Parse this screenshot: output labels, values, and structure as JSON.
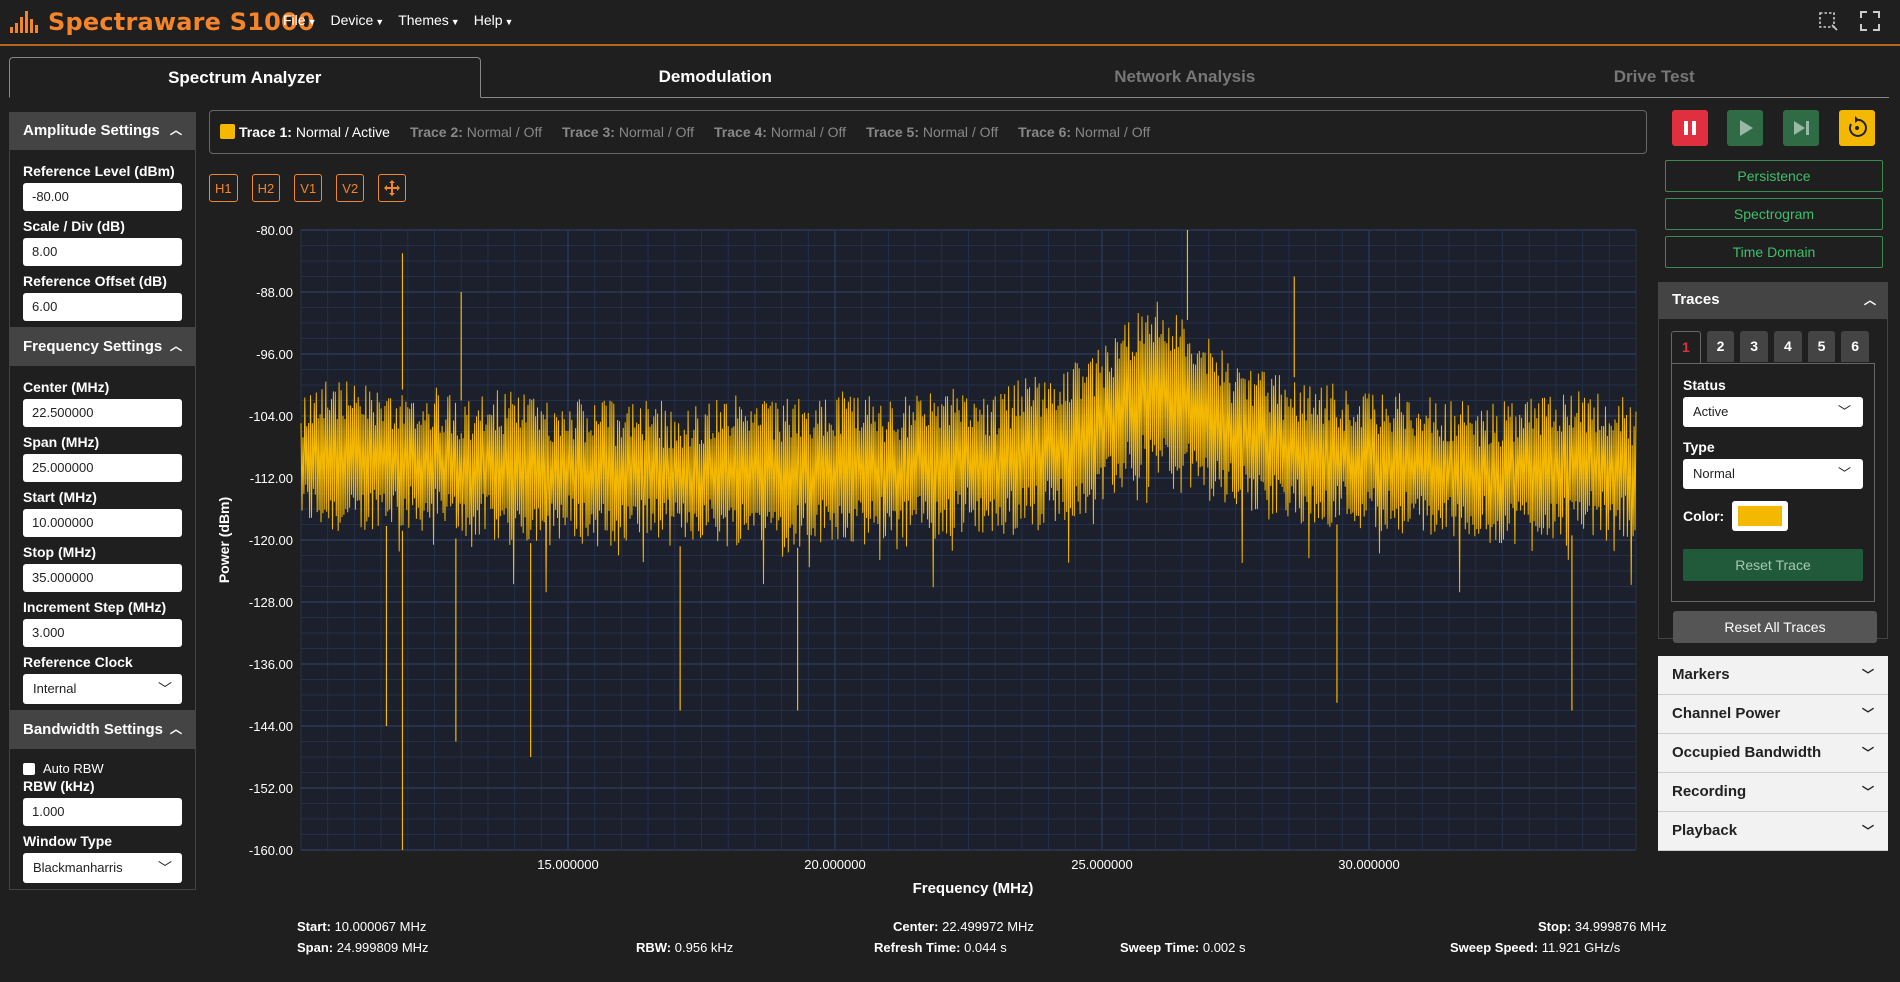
{
  "app": {
    "title": "Spectraware S1000"
  },
  "menu": [
    {
      "label": "File"
    },
    {
      "label": "Device"
    },
    {
      "label": "Themes"
    },
    {
      "label": "Help"
    }
  ],
  "tabs": [
    {
      "label": "Spectrum Analyzer"
    },
    {
      "label": "Demodulation"
    },
    {
      "label": "Network Analysis"
    },
    {
      "label": "Drive Test"
    }
  ],
  "amplitude": {
    "title": "Amplitude Settings",
    "ref_level_label": "Reference Level (dBm)",
    "ref_level": "-80.00",
    "scale_label": "Scale / Div (dB)",
    "scale": "8.00",
    "offset_label": "Reference Offset (dB)",
    "offset": "6.00"
  },
  "frequency": {
    "title": "Frequency Settings",
    "center_label": "Center (MHz)",
    "center": "22.500000",
    "span_label": "Span (MHz)",
    "span": "25.000000",
    "start_label": "Start (MHz)",
    "start": "10.000000",
    "stop_label": "Stop (MHz)",
    "stop": "35.000000",
    "step_label": "Increment Step (MHz)",
    "step": "3.000",
    "clock_label": "Reference Clock",
    "clock": "Internal"
  },
  "bandwidth": {
    "title": "Bandwidth Settings",
    "auto_rbw_label": "Auto RBW",
    "rbw_label": "RBW (kHz)",
    "rbw": "1.000",
    "window_label": "Window Type",
    "window": "Blackmanharris"
  },
  "tracebar": [
    {
      "name": "Trace 1:",
      "state": "Normal / Active",
      "color": "#f5b800"
    },
    {
      "name": "Trace 2:",
      "state": "Normal / Off"
    },
    {
      "name": "Trace 3:",
      "state": "Normal / Off"
    },
    {
      "name": "Trace 4:",
      "state": "Normal / Off"
    },
    {
      "name": "Trace 5:",
      "state": "Normal / Off"
    },
    {
      "name": "Trace 6:",
      "state": "Normal / Off"
    }
  ],
  "tools": [
    "H1",
    "H2",
    "V1",
    "V2"
  ],
  "view_buttons": [
    "Persistence",
    "Spectrogram",
    "Time Domain"
  ],
  "traces_panel": {
    "title": "Traces",
    "tabs": [
      "1",
      "2",
      "3",
      "4",
      "5",
      "6"
    ],
    "status_label": "Status",
    "status": "Active",
    "type_label": "Type",
    "type": "Normal",
    "color_label": "Color:",
    "color": "#f5b800",
    "reset_trace": "Reset Trace",
    "reset_all": "Reset All Traces"
  },
  "accordions": [
    "Markers",
    "Channel Power",
    "Occupied Bandwidth",
    "Recording",
    "Playback"
  ],
  "sweep_info": {
    "start_label": "Start:",
    "start": "10.000067 MHz",
    "span_label": "Span:",
    "span": "24.999809 MHz",
    "rbw_label": "RBW:",
    "rbw": "0.956 kHz",
    "center_label": "Center:",
    "center": "22.499972 MHz",
    "refresh_label": "Refresh Time:",
    "refresh": "0.044 s",
    "sweep_time_label": "Sweep Time:",
    "sweep_time": "0.002 s",
    "stop_label": "Stop:",
    "stop": "34.999876 MHz",
    "sweep_speed_label": "Sweep Speed:",
    "sweep_speed": "11.921 GHz/s"
  },
  "colors": {
    "accent": "#f5852a",
    "trace": "#f5b800",
    "green": "#3fbf6a",
    "pause": "#e03040"
  },
  "chart_data": {
    "type": "line",
    "xlabel": "Frequency (MHz)",
    "ylabel": "Power (dBm)",
    "xlim": [
      10.0,
      35.0
    ],
    "ylim": [
      -160.0,
      -80.0
    ],
    "x_ticks": [
      "15.000000",
      "20.000000",
      "25.000000",
      "30.000000"
    ],
    "x_tick_values": [
      15,
      20,
      25,
      30
    ],
    "y_ticks": [
      "-80.00",
      "-88.00",
      "-96.00",
      "-104.00",
      "-112.00",
      "-120.00",
      "-128.00",
      "-136.00",
      "-144.00",
      "-152.00",
      "-160.00"
    ],
    "y_tick_values": [
      -80,
      -88,
      -96,
      -104,
      -112,
      -120,
      -128,
      -136,
      -144,
      -152,
      -160
    ],
    "series": [
      {
        "color": "#f5b800",
        "x": [
          10.0,
          10.5,
          11.0,
          11.5,
          12.0,
          12.5,
          13.0,
          13.5,
          14.0,
          14.5,
          15.0,
          15.5,
          16.0,
          16.5,
          17.0,
          17.5,
          18.0,
          18.5,
          19.0,
          19.5,
          20.0,
          20.5,
          21.0,
          21.5,
          22.0,
          22.5,
          23.0,
          23.5,
          24.0,
          24.5,
          25.0,
          25.5,
          26.0,
          26.5,
          27.0,
          27.5,
          28.0,
          28.5,
          29.0,
          29.5,
          30.0,
          30.5,
          31.0,
          31.5,
          32.0,
          32.5,
          33.0,
          33.5,
          34.0,
          34.5,
          35.0
        ],
        "upper": [
          -101,
          -98,
          -100,
          -99,
          -101,
          -100,
          -102,
          -101,
          -100,
          -102,
          -101,
          -102,
          -102,
          -101,
          -103,
          -102,
          -101,
          -102,
          -102,
          -101,
          -101,
          -100,
          -102,
          -101,
          -100,
          -100,
          -101,
          -99,
          -98,
          -97,
          -95,
          -91,
          -89,
          -91,
          -94,
          -97,
          -98,
          -99,
          -99,
          -100,
          -101,
          -101,
          -101,
          -102,
          -102,
          -102,
          -101,
          -101,
          -100,
          -101,
          -102
        ],
        "lower": [
          -118,
          -119,
          -120,
          -118,
          -119,
          -119,
          -120,
          -120,
          -121,
          -120,
          -120,
          -121,
          -121,
          -120,
          -121,
          -120,
          -121,
          -120,
          -121,
          -121,
          -120,
          -121,
          -120,
          -120,
          -120,
          -119,
          -120,
          -119,
          -118,
          -117,
          -116,
          -113,
          -112,
          -113,
          -115,
          -116,
          -117,
          -118,
          -118,
          -118,
          -119,
          -119,
          -120,
          -120,
          -120,
          -121,
          -120,
          -120,
          -119,
          -120,
          -120
        ],
        "spikes": [
          {
            "x": 11.9,
            "y": -83
          },
          {
            "x": 13.0,
            "y": -88
          },
          {
            "x": 26.6,
            "y": -80
          },
          {
            "x": 28.6,
            "y": -86
          },
          {
            "x": 11.9,
            "y": -160
          },
          {
            "x": 11.6,
            "y": -144
          },
          {
            "x": 12.9,
            "y": -146
          },
          {
            "x": 14.3,
            "y": -148
          },
          {
            "x": 17.1,
            "y": -142
          },
          {
            "x": 19.3,
            "y": -142
          },
          {
            "x": 29.4,
            "y": -141
          },
          {
            "x": 33.8,
            "y": -142
          }
        ]
      }
    ]
  }
}
